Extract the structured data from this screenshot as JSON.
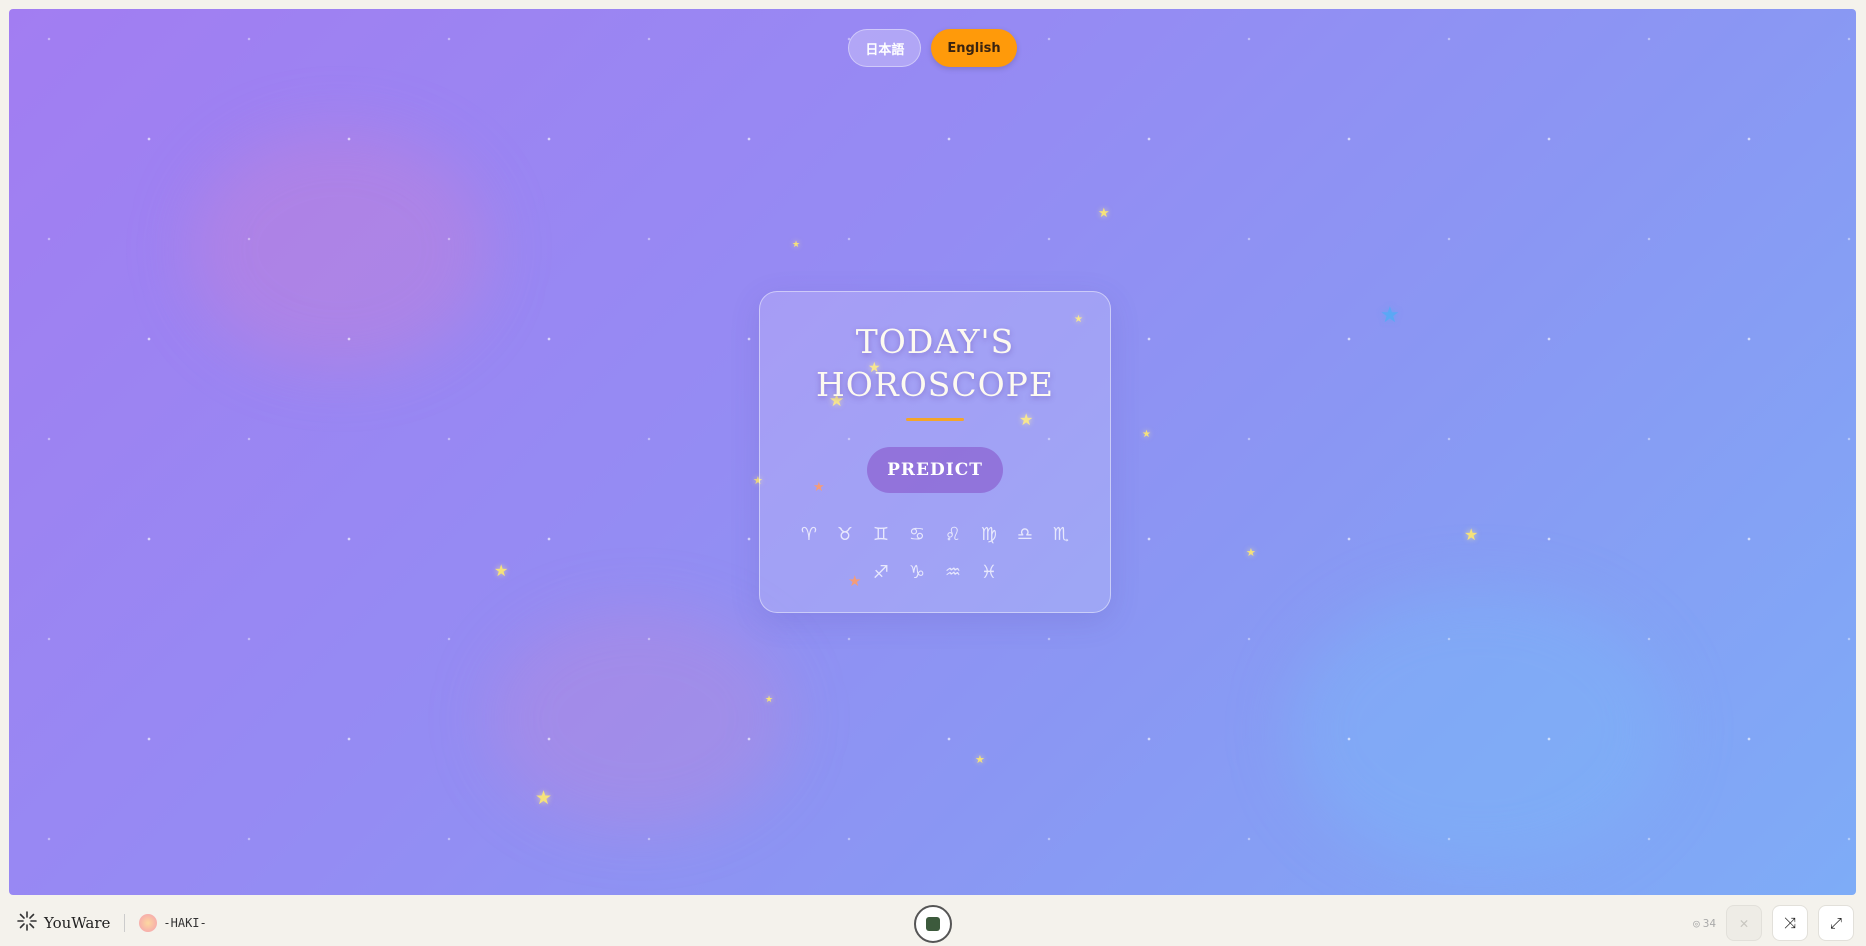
{
  "languages": {
    "japanese": "日本語",
    "english": "English",
    "active": "English"
  },
  "card": {
    "title_line1": "TODAY'S",
    "title_line2": "HOROSCOPE",
    "predict_label": "PREDICT",
    "zodiac": [
      "♈︎",
      "♉︎",
      "♊︎",
      "♋︎",
      "♌︎",
      "♍︎",
      "♎︎",
      "♏︎",
      "♐︎",
      "♑︎",
      "♒︎",
      "♓︎"
    ]
  },
  "footer": {
    "brand": "YouWare",
    "author": "-HAKI-",
    "views": "34"
  },
  "colors": {
    "accent_orange": "#ff9a0a",
    "title_underline": "#f4a52a",
    "background_start": "#a27df2",
    "background_end": "#7eacf7"
  }
}
